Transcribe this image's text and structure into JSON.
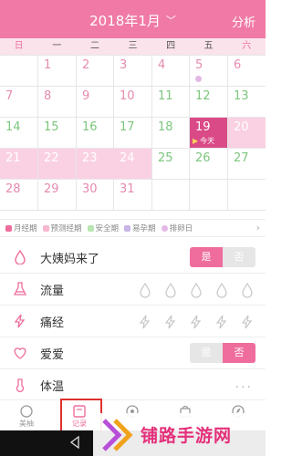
{
  "header": {
    "title": "2018年1月",
    "analysis": "分析"
  },
  "weekdays": [
    "日",
    "一",
    "二",
    "三",
    "四",
    "五",
    "六"
  ],
  "calendar": {
    "weeks": [
      [
        {
          "day": ""
        },
        {
          "day": "1"
        },
        {
          "day": "2"
        },
        {
          "day": "3"
        },
        {
          "day": "4"
        },
        {
          "day": "5"
        },
        {
          "day": "6"
        }
      ],
      [
        {
          "day": "7"
        },
        {
          "day": "8"
        },
        {
          "day": "9"
        },
        {
          "day": "10"
        },
        {
          "day": "11"
        },
        {
          "day": "12"
        },
        {
          "day": "13"
        }
      ],
      [
        {
          "day": "14"
        },
        {
          "day": "15"
        },
        {
          "day": "16"
        },
        {
          "day": "17"
        },
        {
          "day": "18"
        },
        {
          "day": "19"
        },
        {
          "day": "20"
        }
      ],
      [
        {
          "day": "21"
        },
        {
          "day": "22"
        },
        {
          "day": "23"
        },
        {
          "day": "24"
        },
        {
          "day": "25"
        },
        {
          "day": "26"
        },
        {
          "day": "27"
        }
      ],
      [
        {
          "day": "28"
        },
        {
          "day": "29"
        },
        {
          "day": "30"
        },
        {
          "day": "31"
        },
        {
          "day": ""
        },
        {
          "day": ""
        },
        {
          "day": ""
        }
      ]
    ],
    "today_label": "今天"
  },
  "legend": [
    {
      "label": "月经期",
      "color": "#ef6d9c"
    },
    {
      "label": "预测经期",
      "color": "#f7b7cf"
    },
    {
      "label": "安全期",
      "color": "#b9e6b0"
    },
    {
      "label": "易孕期",
      "color": "#c9b5e8"
    },
    {
      "label": "排卵日",
      "color": "#e4b8e6"
    }
  ],
  "records": {
    "period_came": {
      "label": "大姨妈来了",
      "yes": "是",
      "no": "否",
      "selected": "是"
    },
    "flow": {
      "label": "流量"
    },
    "cramps": {
      "label": "痛经"
    },
    "love": {
      "label": "爱爱",
      "yes": "是",
      "no": "否",
      "selected": "否"
    },
    "temperature": {
      "label": "体温"
    }
  },
  "tabs": [
    {
      "label": "美柚"
    },
    {
      "label": "记录"
    },
    {
      "label": ""
    },
    {
      "label": ""
    },
    {
      "label": ""
    }
  ],
  "watermark": {
    "text": "铺路手游网"
  },
  "colors": {
    "brand": "#f07aa5",
    "accent": "#ef6d9c",
    "today": "#d94a86"
  }
}
